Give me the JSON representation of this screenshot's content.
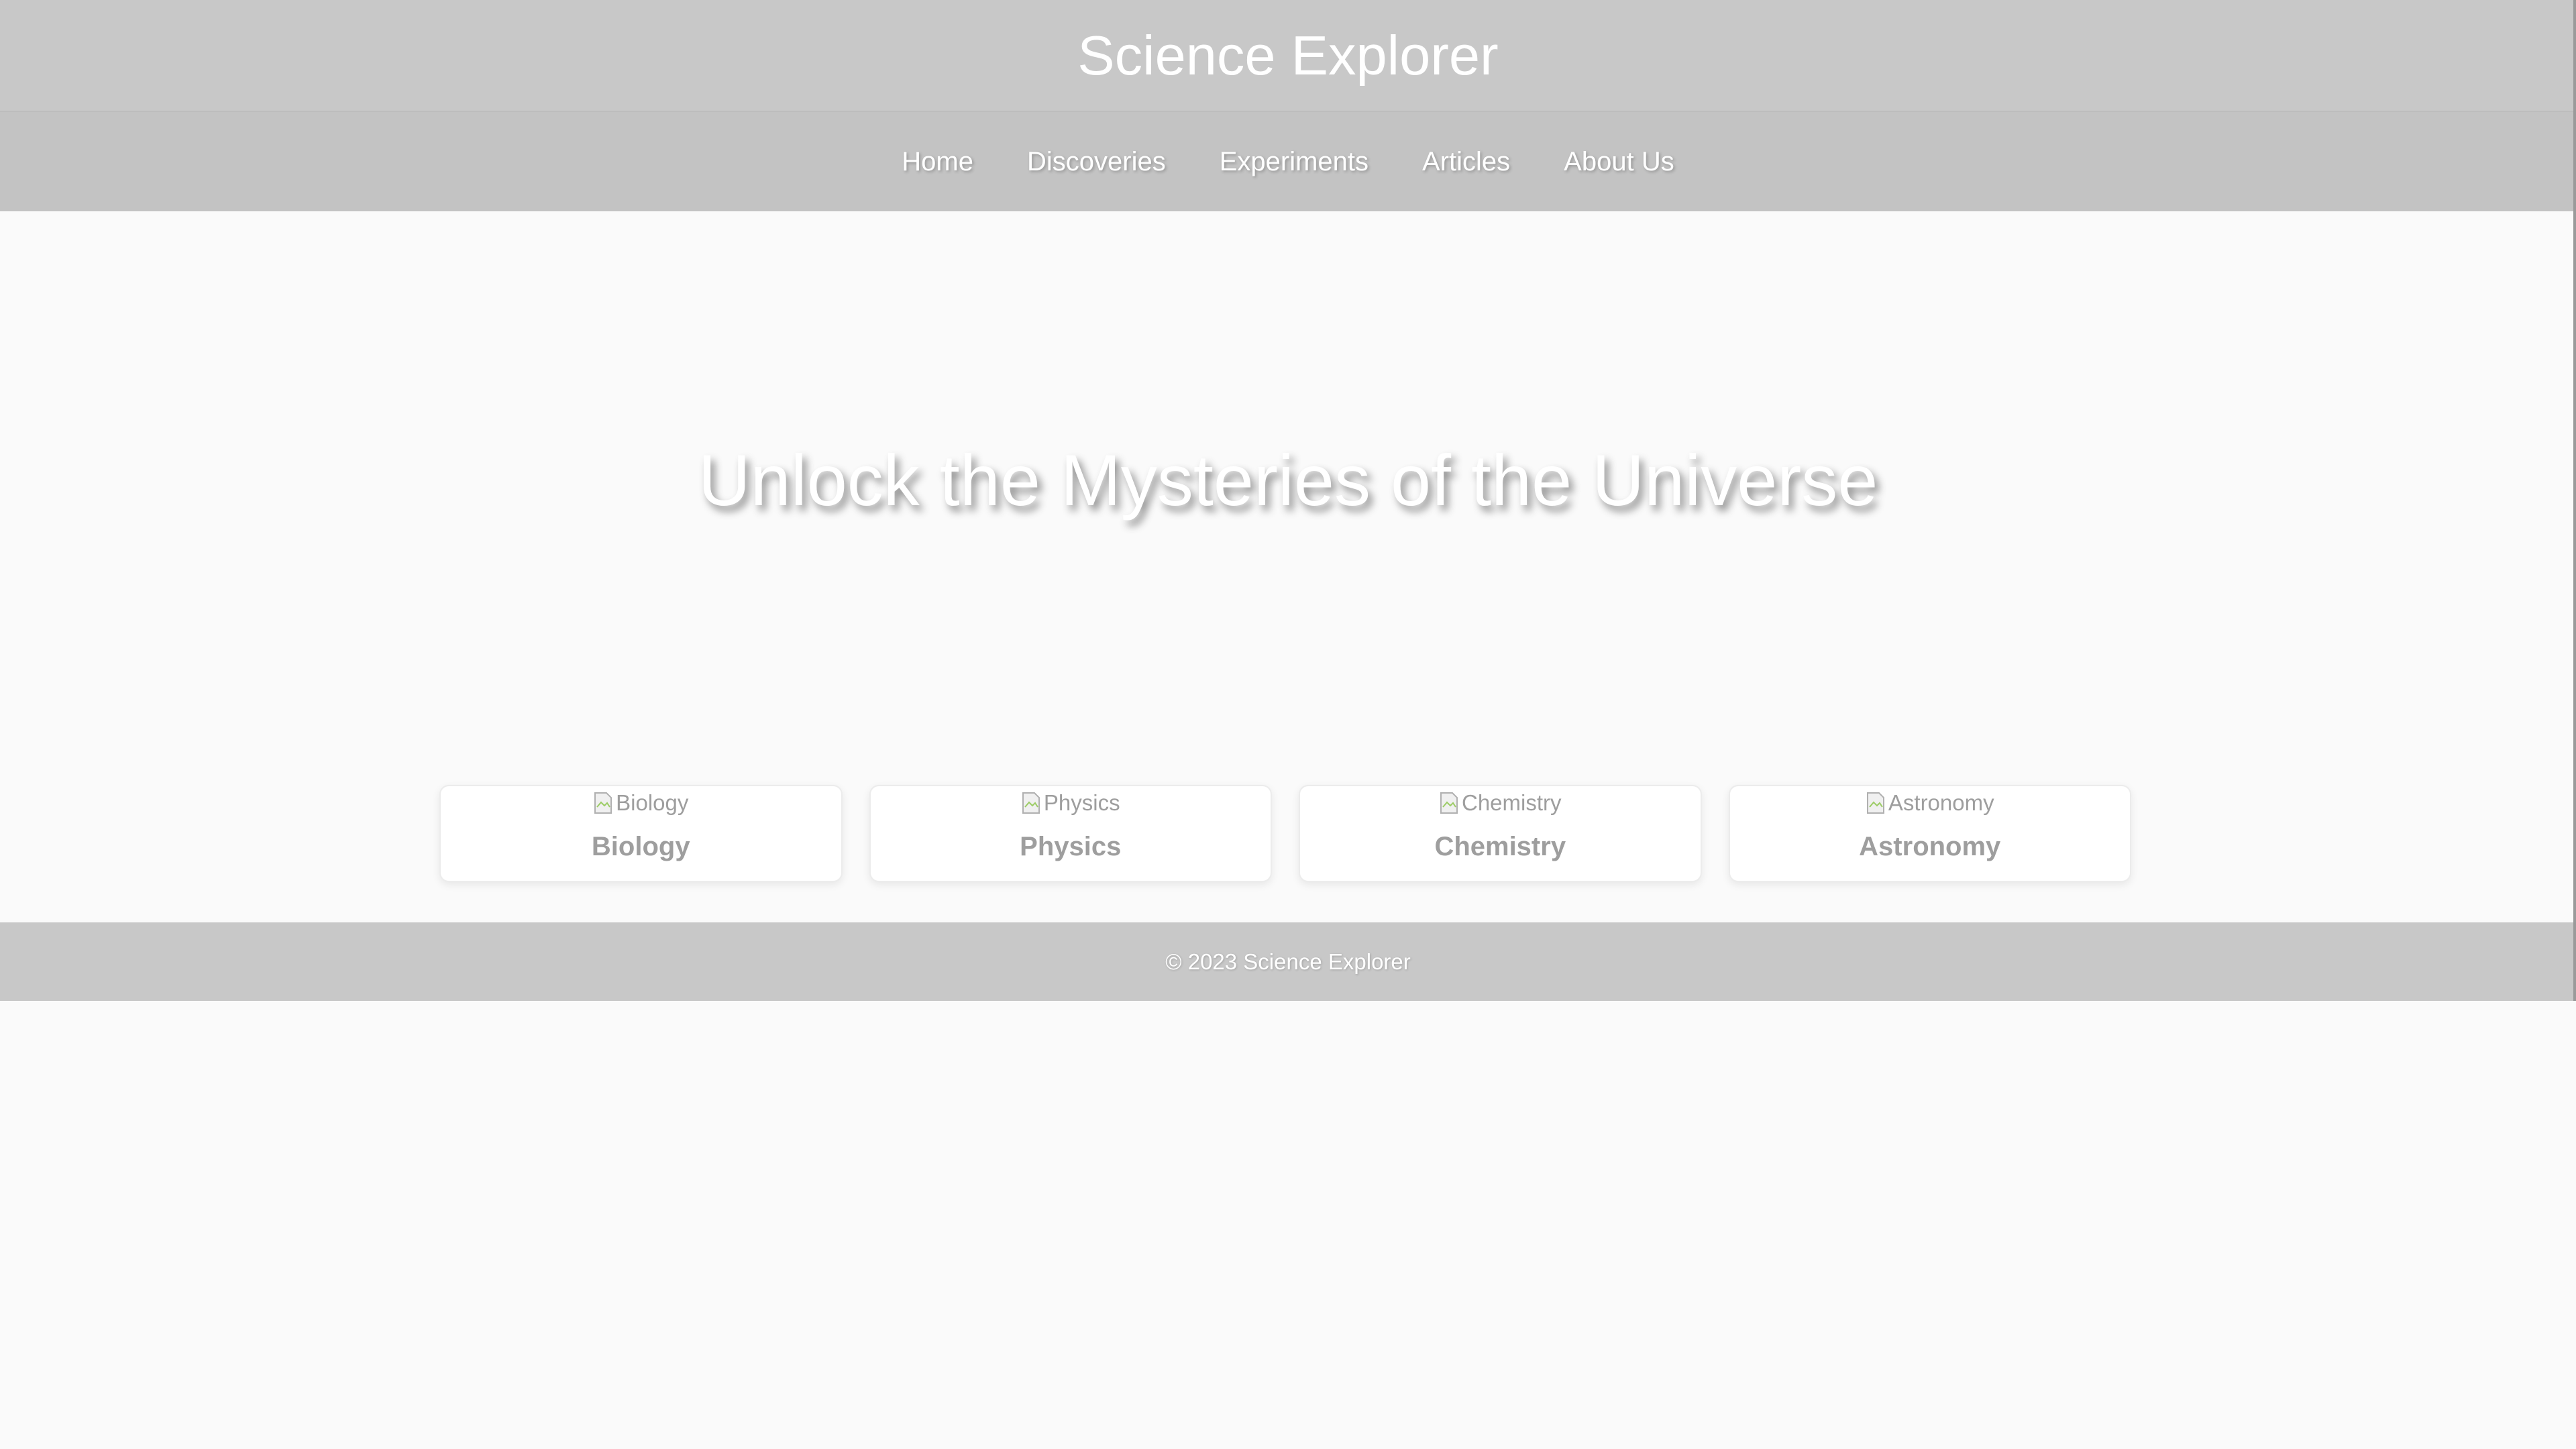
{
  "header": {
    "title": "Science Explorer"
  },
  "nav": {
    "items": [
      {
        "label": "Home"
      },
      {
        "label": "Discoveries"
      },
      {
        "label": "Experiments"
      },
      {
        "label": "Articles"
      },
      {
        "label": "About Us"
      }
    ]
  },
  "hero": {
    "title": "Unlock the Mysteries of the Universe"
  },
  "categories": [
    {
      "image_alt": "Biology",
      "name": "Biology"
    },
    {
      "image_alt": "Physics",
      "name": "Physics"
    },
    {
      "image_alt": "Chemistry",
      "name": "Chemistry"
    },
    {
      "image_alt": "Astronomy",
      "name": "Astronomy"
    }
  ],
  "footer": {
    "text": "© 2023 Science Explorer"
  },
  "colors": {
    "header_bg": "#c8c8c8",
    "nav_bg": "#c3c3c3",
    "page_bg": "#fafafa",
    "card_text": "#9e9e9e"
  },
  "icons": {
    "broken_image": "broken-image-icon"
  }
}
